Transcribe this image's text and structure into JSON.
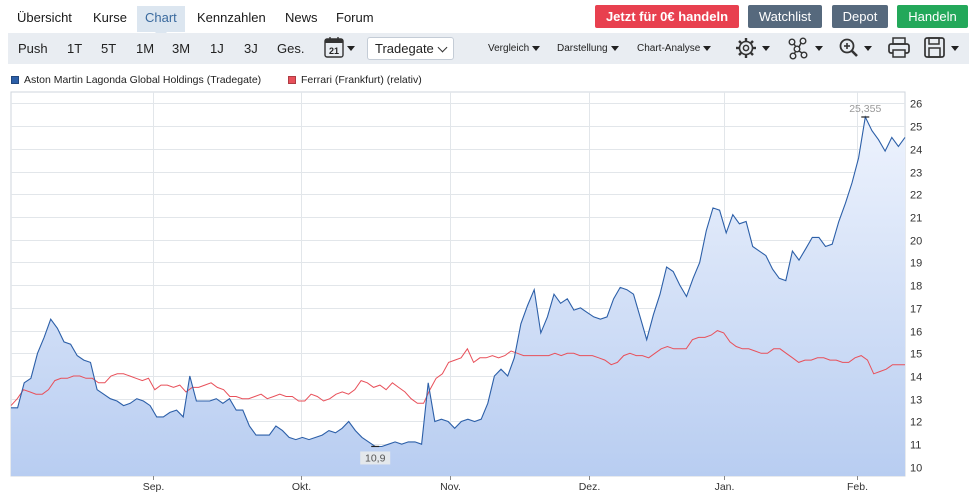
{
  "nav": {
    "tabs": [
      {
        "label": "Übersicht",
        "active": false
      },
      {
        "label": "Kurse",
        "active": false
      },
      {
        "label": "Chart",
        "active": true
      },
      {
        "label": "Kennzahlen",
        "active": false
      },
      {
        "label": "News",
        "active": false
      },
      {
        "label": "Forum",
        "active": false
      }
    ],
    "actions": {
      "trade_free": "Jetzt für 0€ handeln",
      "watchlist": "Watchlist",
      "depot": "Depot",
      "handeln": "Handeln"
    }
  },
  "toolbar": {
    "periods": [
      "Push",
      "1T",
      "5T",
      "1M",
      "3M",
      "1J",
      "3J",
      "Ges."
    ],
    "calendar_day": "21",
    "exchange": "Tradegate",
    "menus": [
      "Vergleich",
      "Darstellung",
      "Chart-Analyse"
    ]
  },
  "colors": {
    "accent": "#3a6a9e",
    "trade_button": "#e8404f",
    "slate_button": "#56697d",
    "green_button": "#23a85a",
    "series_aston": "#2c5fa8",
    "series_ferrari": "#e8505a"
  },
  "icons": [
    "calendar-icon",
    "gear-icon",
    "indicators-icon",
    "zoom-icon",
    "print-icon",
    "save-icon"
  ],
  "chart_data": {
    "type": "area",
    "x_ticks": [
      "Sep.",
      "Okt.",
      "Nov.",
      "Dez.",
      "Jan.",
      "Feb."
    ],
    "y_ticks": [
      10,
      11,
      12,
      13,
      14,
      15,
      16,
      17,
      18,
      19,
      20,
      21,
      22,
      23,
      24,
      25,
      26
    ],
    "ylim": [
      9.6,
      26.5
    ],
    "grid": true,
    "legend_position": "top-left",
    "annotations": {
      "max": "25,355",
      "min": "10,9"
    },
    "series": [
      {
        "name": "Aston Martin Lagonda Global Holdings (Tradegate)",
        "color": "#2c5fa8",
        "fill": true,
        "values": [
          12.6,
          12.6,
          13.7,
          13.9,
          15.0,
          15.7,
          16.5,
          16.1,
          15.5,
          15.4,
          14.9,
          14.7,
          14.6,
          13.4,
          13.2,
          13.0,
          12.9,
          12.7,
          12.8,
          13.0,
          12.9,
          12.7,
          12.2,
          12.2,
          12.4,
          12.5,
          12.2,
          14.0,
          12.9,
          12.9,
          12.9,
          13.0,
          12.8,
          13.0,
          12.5,
          12.5,
          11.8,
          11.4,
          11.4,
          11.4,
          11.8,
          11.6,
          11.3,
          11.2,
          11.3,
          11.2,
          11.3,
          11.4,
          11.6,
          11.5,
          11.7,
          12.0,
          11.6,
          11.3,
          11.1,
          10.9,
          10.9,
          11.0,
          11.1,
          11.0,
          11.1,
          11.1,
          11.0,
          13.7,
          12.0,
          12.1,
          12.0,
          11.7,
          12.0,
          12.1,
          12.0,
          12.1,
          12.8,
          14.0,
          14.3,
          14.0,
          14.8,
          16.3,
          17.1,
          17.8,
          15.9,
          16.6,
          17.6,
          17.2,
          17.4,
          16.9,
          17.0,
          16.8,
          16.6,
          16.5,
          16.6,
          17.4,
          17.9,
          17.8,
          17.6,
          16.6,
          15.6,
          16.7,
          17.6,
          18.8,
          18.6,
          18.0,
          17.5,
          18.3,
          19.0,
          20.4,
          21.4,
          21.3,
          20.3,
          21.1,
          20.7,
          20.8,
          19.7,
          19.5,
          19.3,
          18.7,
          18.3,
          18.2,
          19.5,
          19.1,
          19.6,
          20.1,
          20.1,
          19.7,
          19.8,
          20.8,
          21.6,
          22.5,
          23.6,
          25.4,
          24.8,
          24.4,
          23.9,
          24.5,
          24.1,
          24.5
        ]
      },
      {
        "name": "Ferrari (Frankfurt) (relativ)",
        "color": "#e8505a",
        "fill": false,
        "values": [
          12.7,
          13.0,
          13.4,
          13.3,
          13.2,
          13.2,
          13.4,
          13.8,
          13.9,
          13.9,
          14.0,
          14.0,
          13.9,
          13.9,
          13.7,
          13.7,
          14.0,
          14.1,
          14.1,
          14.0,
          13.9,
          13.8,
          13.9,
          13.4,
          13.6,
          13.6,
          13.5,
          13.6,
          13.3,
          13.5,
          13.5,
          13.6,
          13.7,
          13.5,
          13.4,
          13.1,
          13.1,
          13.0,
          13.0,
          13.1,
          13.2,
          13.0,
          13.1,
          13.2,
          13.1,
          13.1,
          12.9,
          12.9,
          13.2,
          13.1,
          12.9,
          13.0,
          13.2,
          13.3,
          13.2,
          13.4,
          13.8,
          13.7,
          13.5,
          13.6,
          13.4,
          13.7,
          13.5,
          13.3,
          13.0,
          12.8,
          12.8,
          13.4,
          13.9,
          14.1,
          14.6,
          14.7,
          14.8,
          15.2,
          14.6,
          14.8,
          14.8,
          14.9,
          14.8,
          14.9,
          15.1,
          15.0,
          14.9,
          14.9,
          14.9,
          14.9,
          14.9,
          15.0,
          14.9,
          15.0,
          15.0,
          14.9,
          14.9,
          14.9,
          14.8,
          14.7,
          14.5,
          14.6,
          14.9,
          15.0,
          14.9,
          14.9,
          14.8,
          15.0,
          15.2,
          15.3,
          15.2,
          15.2,
          15.2,
          15.6,
          15.7,
          15.7,
          15.8,
          16.0,
          15.9,
          15.5,
          15.3,
          15.2,
          15.2,
          15.1,
          15.0,
          15.0,
          15.2,
          15.2,
          15.0,
          14.8,
          14.6,
          14.7,
          14.7,
          14.8,
          14.8,
          14.7,
          14.7,
          14.6,
          14.6,
          14.8,
          14.9,
          14.7,
          14.1,
          14.2,
          14.3,
          14.5,
          14.5,
          14.5
        ]
      }
    ]
  }
}
